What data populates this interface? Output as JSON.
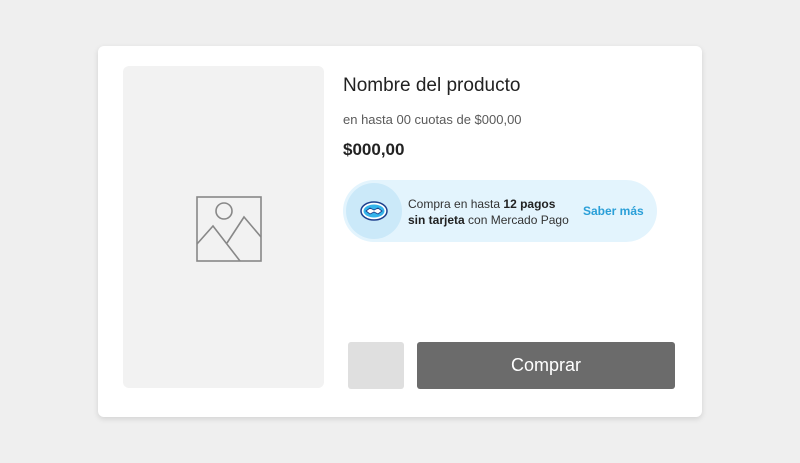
{
  "product": {
    "name": "Nombre del producto",
    "installments_text": "en hasta 00 cuotas de $000,00",
    "price": "$000,00"
  },
  "mercado_pago_banner": {
    "text_prefix": "Compra en hasta ",
    "text_bold": "12 pagos sin tarjeta",
    "text_suffix": " con Mercado Pago",
    "link_label": "Saber más",
    "icon": "mercado-pago-handshake-icon"
  },
  "actions": {
    "buy_label": "Comprar"
  },
  "icons": {
    "image_placeholder": "image-placeholder-icon"
  },
  "colors": {
    "background": "#efefef",
    "card": "#ffffff",
    "image_placeholder": "#f2f2f2",
    "banner_background": "#e3f4fd",
    "link": "#2a9fd8",
    "buy_button": "#6b6b6b",
    "qty_box": "#dfdfdf"
  }
}
